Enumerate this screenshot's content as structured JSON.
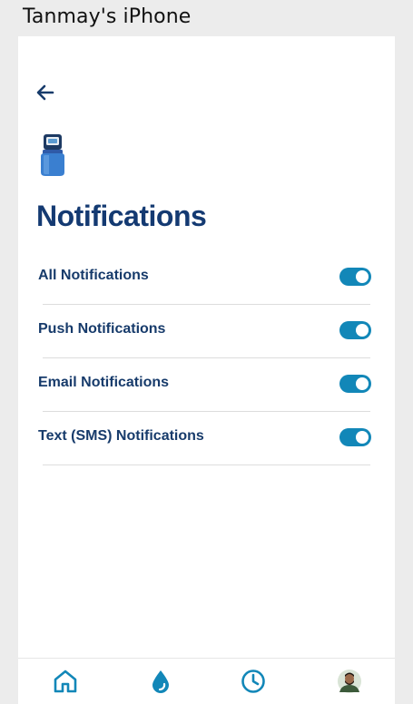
{
  "window": {
    "title": "Tanmay's iPhone"
  },
  "header": {
    "back_icon": "arrow-left-icon",
    "device_icon": "water-softener-icon"
  },
  "page": {
    "title": "Notifications"
  },
  "settings": [
    {
      "label": "All Notifications",
      "enabled": true
    },
    {
      "label": "Push Notifications",
      "enabled": true
    },
    {
      "label": "Email Notifications",
      "enabled": true
    },
    {
      "label": "Text (SMS) Notifications",
      "enabled": true
    }
  ],
  "bottom_nav": [
    {
      "icon": "home-icon"
    },
    {
      "icon": "water-drop-icon"
    },
    {
      "icon": "clock-icon"
    },
    {
      "icon": "user-avatar"
    }
  ],
  "colors": {
    "title": "#143a72",
    "toggle_on": "#1287b8",
    "nav_icon": "#1287b8"
  }
}
